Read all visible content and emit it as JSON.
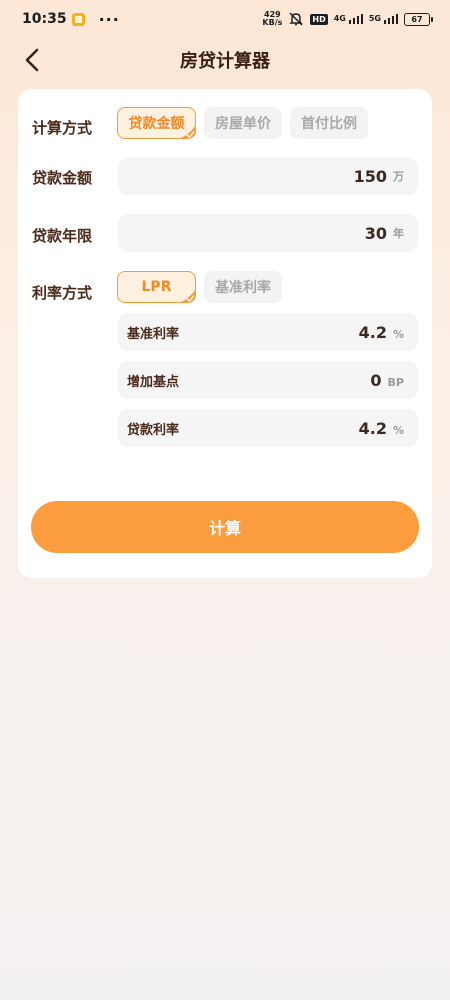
{
  "status_bar": {
    "time": "10:35",
    "dots": "···",
    "net_speed_top": "429",
    "net_speed_bottom": "KB/s",
    "hd": "HD",
    "sig1": "4G",
    "sig2": "5G",
    "battery": "67"
  },
  "nav": {
    "title": "房贷计算器"
  },
  "calc_method": {
    "label": "计算方式",
    "options": [
      "贷款金额",
      "房屋单价",
      "首付比例"
    ],
    "selected": "贷款金额"
  },
  "loan_amount": {
    "label": "贷款金额",
    "value": "150",
    "unit": "万"
  },
  "loan_term": {
    "label": "贷款年限",
    "value": "30",
    "unit": "年"
  },
  "rate_method": {
    "label": "利率方式",
    "options": [
      "LPR",
      "基准利率"
    ],
    "selected": "LPR",
    "rows": [
      {
        "label": "基准利率",
        "value": "4.2",
        "unit": "%"
      },
      {
        "label": "增加基点",
        "value": "0",
        "unit": "BP"
      },
      {
        "label": "贷款利率",
        "value": "4.2",
        "unit": "%"
      }
    ]
  },
  "actions": {
    "calculate": "计算"
  },
  "colors": {
    "accent": "#fb9d3e",
    "accent_border": "#f59b3c",
    "accent_bg": "#fff1e0"
  }
}
